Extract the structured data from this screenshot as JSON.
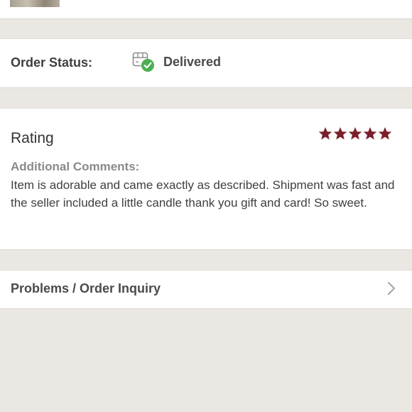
{
  "order_status": {
    "label": "Order Status:",
    "value": "Delivered",
    "icon": "package-delivered-icon",
    "status_color": "#4caf50"
  },
  "rating": {
    "title": "Rating",
    "stars": 5,
    "max_stars": 5,
    "star_color": "#7a1f2b",
    "comments_label": "Additional Comments:",
    "comments": "Item is adorable and came exactly as described. Shipment was fast and the seller included a little candle thank you gift and card! So sweet."
  },
  "inquiry": {
    "label": "Problems / Order Inquiry",
    "icon": "chevron-right-icon"
  }
}
